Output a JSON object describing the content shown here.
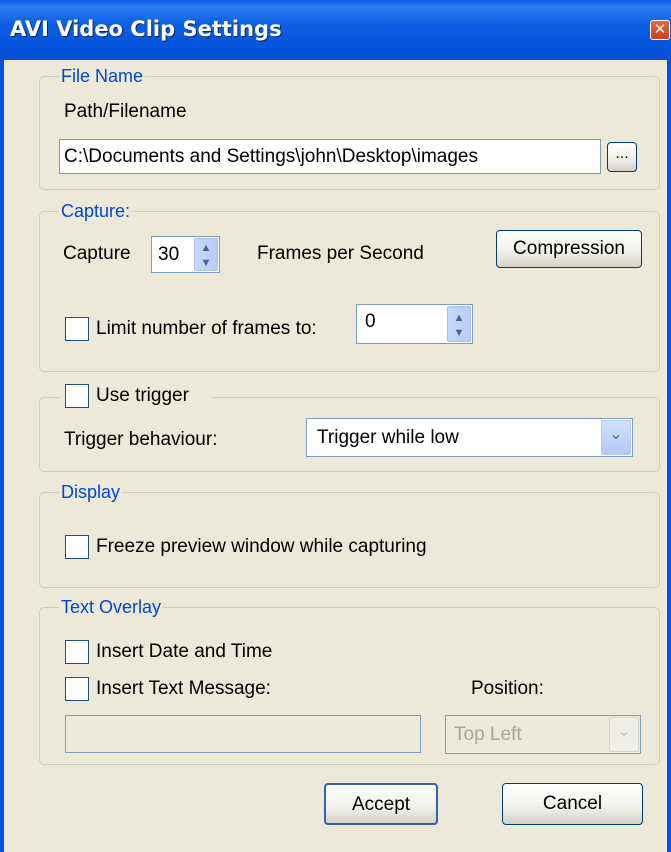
{
  "window": {
    "title": "AVI Video Clip Settings",
    "close_glyph": "✕"
  },
  "file_name": {
    "legend": "File Name",
    "path_label": "Path/Filename",
    "path_value": "C:\\Documents and Settings\\john\\Desktop\\images",
    "browse_label": "..."
  },
  "capture": {
    "legend": "Capture:",
    "capture_label": "Capture",
    "fps_value": "30",
    "fps_label": "Frames per Second",
    "compression_label": "Compression",
    "limit_label": "Limit number of frames to:",
    "limit_value": "0",
    "limit_checked": false
  },
  "trigger": {
    "use_trigger_label": "Use trigger",
    "use_trigger_checked": false,
    "behaviour_label": "Trigger behaviour:",
    "behaviour_value": "Trigger while low"
  },
  "display": {
    "legend": "Display",
    "freeze_label": "Freeze preview window while capturing",
    "freeze_checked": false
  },
  "text_overlay": {
    "legend": "Text Overlay",
    "insert_datetime_label": "Insert Date and Time",
    "insert_datetime_checked": false,
    "insert_message_label": "Insert Text Message:",
    "insert_message_checked": false,
    "message_value": "",
    "position_label": "Position:",
    "position_value": "Top Left"
  },
  "footer": {
    "accept_label": "Accept",
    "cancel_label": "Cancel"
  },
  "icons": {
    "spin_up": "▲",
    "spin_down": "▼",
    "dropdown": "⌄"
  },
  "colors": {
    "title_bar": "#0054E3",
    "legend_text": "#0046D5",
    "dialog_bg": "#ECE9D8"
  }
}
